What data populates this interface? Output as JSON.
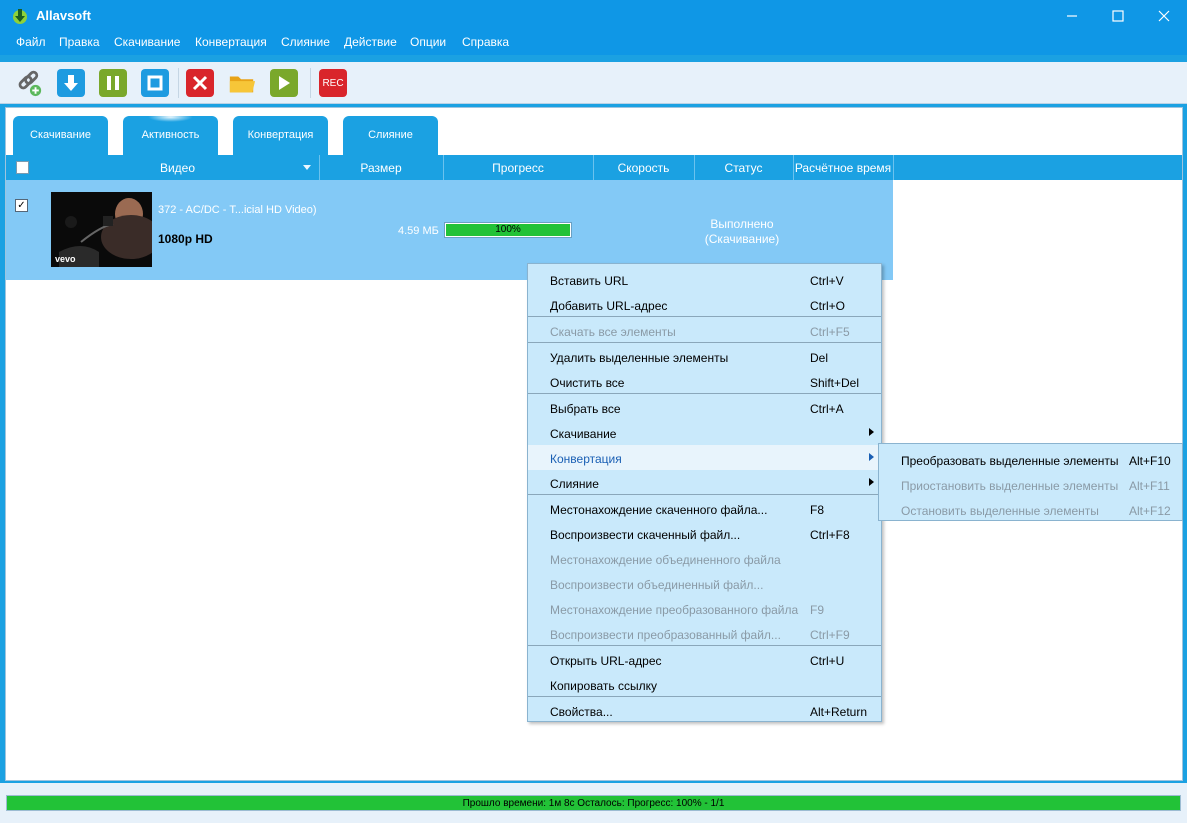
{
  "window": {
    "title": "Allavsoft",
    "accent": "#0f97e6"
  },
  "menu": [
    "Файл",
    "Правка",
    "Скачивание",
    "Конвертация",
    "Слияние",
    "Действие",
    "Опции",
    "Справка"
  ],
  "toolbar": {
    "buttons": [
      "add-url-icon",
      "download-icon",
      "pause-icon",
      "stop-icon",
      "delete-icon",
      "open-folder-icon",
      "play-icon",
      "record-icon"
    ],
    "rec_label": "REC"
  },
  "tabs": [
    "Скачивание",
    "Активность",
    "Конвертация",
    "Слияние"
  ],
  "table": {
    "columns": [
      "Видео",
      "Размер",
      "Прогресс",
      "Скорость",
      "Статус",
      "Расчётное время"
    ],
    "rows": [
      {
        "checked": true,
        "check_mark": "✓",
        "name": "372 - AC/DC - T...icial HD Video)",
        "quality": "1080p HD",
        "thumb_logo": "vevo",
        "size": "4.59 МБ",
        "progress": 1.0,
        "progress_text": "100%",
        "status_line1": "Выполнено",
        "status_line2": "(Скачивание)"
      }
    ]
  },
  "context_menu": {
    "items": [
      {
        "label": "Вставить URL",
        "shortcut": "Ctrl+V"
      },
      {
        "label": "Добавить URL-адрес",
        "shortcut": "Ctrl+O"
      },
      {
        "label": "Скачать все элементы",
        "shortcut": "Ctrl+F5",
        "disabled": true
      },
      {
        "label": "Удалить выделенные элементы",
        "shortcut": "Del"
      },
      {
        "label": "Очистить все",
        "shortcut": "Shift+Del"
      },
      {
        "label": "Выбрать все",
        "shortcut": "Ctrl+A"
      },
      {
        "label": "Скачивание",
        "submenu": true
      },
      {
        "label": "Конвертация",
        "submenu": true,
        "highlighted": true
      },
      {
        "label": "Слияние",
        "submenu": true
      },
      {
        "label": "Местонахождение скаченного файла...",
        "shortcut": "F8"
      },
      {
        "label": "Воспроизвести скаченный файл...",
        "shortcut": "Ctrl+F8"
      },
      {
        "label": "Местонахождение объединенного файла",
        "disabled": true
      },
      {
        "label": "Воспроизвести объединенный файл...",
        "disabled": true
      },
      {
        "label": "Местонахождение преобразованного файла",
        "shortcut": "F9",
        "disabled": true
      },
      {
        "label": "Воспроизвести преобразованный файл...",
        "shortcut": "Ctrl+F9",
        "disabled": true
      },
      {
        "label": "Открыть URL-адрес",
        "shortcut": "Ctrl+U"
      },
      {
        "label": "Копировать ссылку"
      },
      {
        "label": "Свойства...",
        "shortcut": "Alt+Return"
      }
    ]
  },
  "submenu": {
    "items": [
      {
        "label": "Преобразовать выделенные элементы",
        "shortcut": "Alt+F10"
      },
      {
        "label": "Приостановить выделенные элементы",
        "shortcut": "Alt+F11",
        "disabled": true
      },
      {
        "label": "Остановить выделенные элементы",
        "shortcut": "Alt+F12",
        "disabled": true
      }
    ]
  },
  "statusbar": {
    "text": "Прошло времени: 1м 8с Осталось: Прогресс: 100% - 1/1",
    "progress": 1.0
  }
}
